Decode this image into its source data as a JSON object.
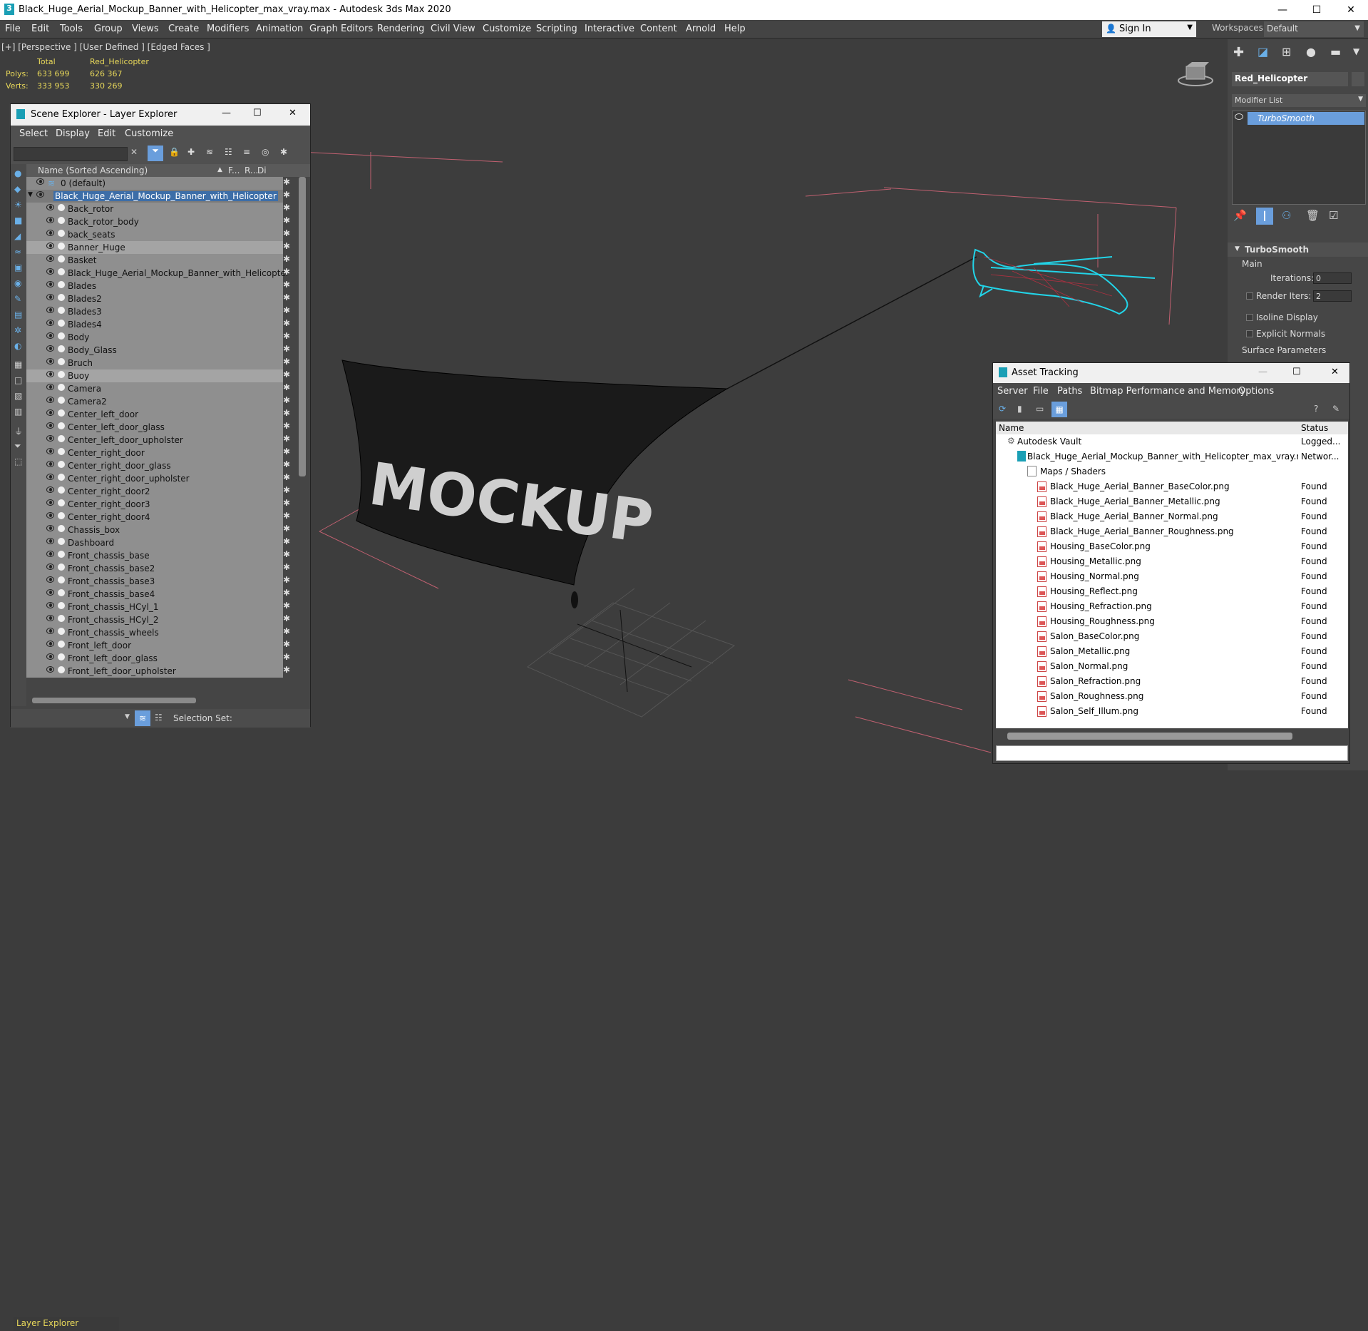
{
  "title": "Black_Huge_Aerial_Mockup_Banner_with_Helicopter_max_vray.max - Autodesk 3ds Max 2020",
  "menu": [
    "File",
    "Edit",
    "Tools",
    "Group",
    "Views",
    "Create",
    "Modifiers",
    "Animation",
    "Graph Editors",
    "Rendering",
    "Civil View",
    "Customize",
    "Scripting",
    "Interactive",
    "Content",
    "Arnold",
    "Help"
  ],
  "sign_in": "Sign In",
  "workspaces_label": "Workspaces:",
  "workspace": "Default",
  "viewport_label": "[+] [Perspective ] [User Defined ] [Edged Faces ]",
  "stats": {
    "total": "Total",
    "object": "Red_Helicopter",
    "polys_label": "Polys:",
    "polys_total": "633 699",
    "polys_obj": "626 367",
    "verts_label": "Verts:",
    "verts_total": "333 953",
    "verts_obj": "330 269"
  },
  "banner_text": "MOCKUP",
  "scene_explorer": {
    "title": "Scene Explorer - Layer Explorer",
    "menu": [
      "Select",
      "Display",
      "Edit",
      "Customize"
    ],
    "column": "Name (Sorted Ascending)",
    "col_f": "F...",
    "col_r": "R...",
    "col_d": "Di",
    "layer_default": "0 (default)",
    "layer_main": "Black_Huge_Aerial_Mockup_Banner_with_Helicopter",
    "items": [
      "Back_rotor",
      "Back_rotor_body",
      "back_seats",
      "Banner_Huge",
      "Basket",
      "Black_Huge_Aerial_Mockup_Banner_with_Helicopter",
      "Blades",
      "Blades2",
      "Blades3",
      "Blades4",
      "Body",
      "Body_Glass",
      "Bruch",
      "Buoy",
      "Camera",
      "Camera2",
      "Center_left_door",
      "Center_left_door_glass",
      "Center_left_door_upholster",
      "Center_right_door",
      "Center_right_door_glass",
      "Center_right_door_upholster",
      "Center_right_door2",
      "Center_right_door3",
      "Center_right_door4",
      "Chassis_box",
      "Dashboard",
      "Front_chassis_base",
      "Front_chassis_base2",
      "Front_chassis_base3",
      "Front_chassis_base4",
      "Front_chassis_HCyl_1",
      "Front_chassis_HCyl_2",
      "Front_chassis_wheels",
      "Front_left_door",
      "Front_left_door_glass",
      "Front_left_door_upholster"
    ],
    "footer_mode": "Layer Explorer",
    "selection_set": "Selection Set:"
  },
  "command_panel": {
    "object_name": "Red_Helicopter",
    "modifier_list": "Modifier List",
    "modifier": "TurboSmooth",
    "rollout": "TurboSmooth",
    "main": "Main",
    "iterations_label": "Iterations:",
    "iterations": "0",
    "render_iters_label": "Render Iters:",
    "render_iters": "2",
    "isoline": "Isoline Display",
    "explicit": "Explicit Normals",
    "surface": "Surface Parameters"
  },
  "asset_tracking": {
    "title": "Asset Tracking",
    "menu": [
      "Server",
      "File",
      "Paths",
      "Bitmap Performance and Memory",
      "Options"
    ],
    "col_name": "Name",
    "col_status": "Status",
    "vault": "Autodesk Vault",
    "vault_status": "Logged...",
    "file": "Black_Huge_Aerial_Mockup_Banner_with_Helicopter_max_vray.max",
    "file_status": "Networ...",
    "maps": "Maps / Shaders",
    "assets": [
      {
        "name": "Black_Huge_Aerial_Banner_BaseColor.png",
        "status": "Found"
      },
      {
        "name": "Black_Huge_Aerial_Banner_Metallic.png",
        "status": "Found"
      },
      {
        "name": "Black_Huge_Aerial_Banner_Normal.png",
        "status": "Found"
      },
      {
        "name": "Black_Huge_Aerial_Banner_Roughness.png",
        "status": "Found"
      },
      {
        "name": "Housing_BaseColor.png",
        "status": "Found"
      },
      {
        "name": "Housing_Metallic.png",
        "status": "Found"
      },
      {
        "name": "Housing_Normal.png",
        "status": "Found"
      },
      {
        "name": "Housing_Reflect.png",
        "status": "Found"
      },
      {
        "name": "Housing_Refraction.png",
        "status": "Found"
      },
      {
        "name": "Housing_Roughness.png",
        "status": "Found"
      },
      {
        "name": "Salon_BaseColor.png",
        "status": "Found"
      },
      {
        "name": "Salon_Metallic.png",
        "status": "Found"
      },
      {
        "name": "Salon_Normal.png",
        "status": "Found"
      },
      {
        "name": "Salon_Refraction.png",
        "status": "Found"
      },
      {
        "name": "Salon_Roughness.png",
        "status": "Found"
      },
      {
        "name": "Salon_Self_Illum.png",
        "status": "Found"
      }
    ]
  }
}
